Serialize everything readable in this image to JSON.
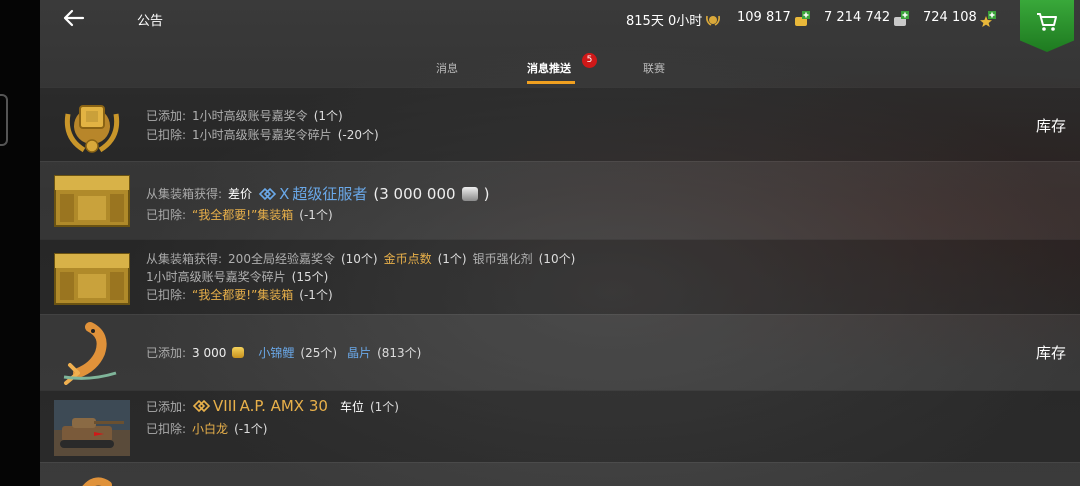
{
  "header": {
    "title": "公告",
    "resources": [
      {
        "label": "815天 0小时",
        "icon": "premium-laurel-icon"
      },
      {
        "label": "109 817",
        "icon": "gold-coins-plus-icon"
      },
      {
        "label": "7 214 742",
        "icon": "silver-coins-plus-icon"
      },
      {
        "label": "724 108",
        "icon": "free-xp-star-plus-icon"
      }
    ]
  },
  "tabs": {
    "items": [
      {
        "label": "消息"
      },
      {
        "label": "消息推送",
        "active": true
      },
      {
        "label": "联赛"
      }
    ],
    "badge": "5"
  },
  "notifications": [
    {
      "lines": [
        {
          "label": "已添加:",
          "text": "1小时高级账号嘉奖令",
          "count": "(1个)"
        },
        {
          "label": "已扣除:",
          "text": "1小时高级账号嘉奖令碎片",
          "count": "(-20个)"
        }
      ],
      "stock": "库存"
    },
    {
      "line1": {
        "label": "从集装箱获得:",
        "tag": "差价",
        "tier": "X",
        "tank": "超级征服者",
        "amount": "(3 000 000",
        "close": ")"
      },
      "line2": {
        "label": "已扣除:",
        "text": "“我全都要!”集装箱",
        "count": "(-1个)"
      }
    },
    {
      "line1": {
        "label": "从集装箱获得:",
        "item1": "200全局经验嘉奖令",
        "count1": "(10个)",
        "item2": "金币点数",
        "count2": "(1个)",
        "item3": "银币强化剂",
        "count3": "(10个)"
      },
      "line2": {
        "text": "1小时高级账号嘉奖令碎片",
        "count": "(15个)"
      },
      "line3": {
        "label": "已扣除:",
        "text": "“我全都要!”集装箱",
        "count": "(-1个)"
      }
    },
    {
      "line1": {
        "label": "已添加:",
        "amount": "3 000",
        "item1": "小锦鲤",
        "count1": "(25个)",
        "item2": "晶片",
        "count2": "(813个)"
      },
      "stock": "库存"
    },
    {
      "line1": {
        "label": "已添加:",
        "tier": "VIII",
        "tank": "A.P. AMX 30",
        "item": "车位",
        "count": "(1个)"
      },
      "line2": {
        "label": "已扣除:",
        "text": "小白龙",
        "count": "(-1个)"
      }
    }
  ],
  "colors": {
    "accent": "#f0a020",
    "gold_text": "#e8b04a",
    "blue_text": "#6aa8e8",
    "badge": "#d01818",
    "shop": "#2e9a30"
  }
}
